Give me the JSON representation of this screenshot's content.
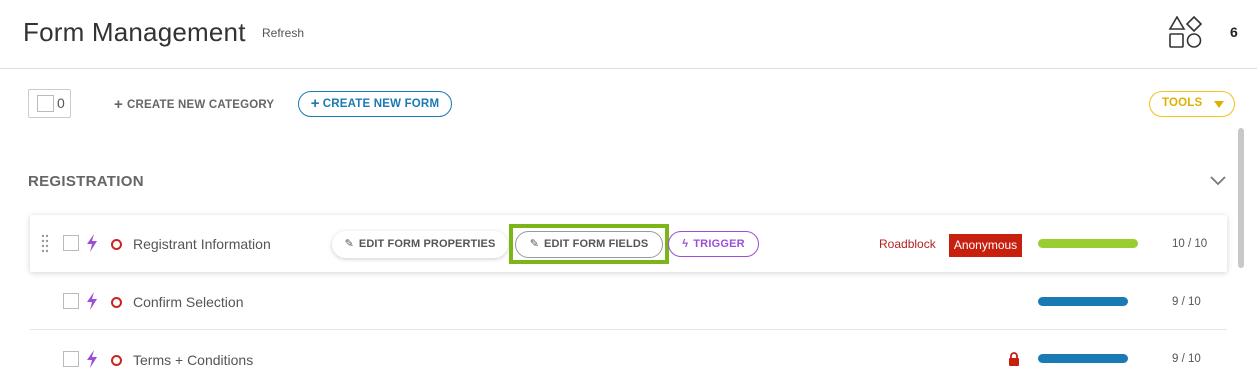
{
  "header": {
    "title": "Form Management",
    "refresh_label": "Refresh",
    "count": "6",
    "shapes_icon": "shapes-icon"
  },
  "toolbar": {
    "selected_count": "0",
    "create_category_label": "CREATE NEW CATEGORY",
    "create_form_label": "CREATE NEW FORM",
    "tools_label": "TOOLS",
    "colors": {
      "primary": "#1a7ab3",
      "tools": "#e0b000"
    }
  },
  "section": {
    "title": "REGISTRATION",
    "collapse_icon": "chevron-down-icon"
  },
  "rows": [
    {
      "name": "Registrant Information",
      "actions": {
        "edit_properties": "EDIT FORM PROPERTIES",
        "edit_fields": "EDIT FORM FIELDS",
        "trigger": "TRIGGER"
      },
      "roadblock": "Roadblock",
      "badge": "Anonymous",
      "progress_text": "10 / 10",
      "progress_value": 1.0,
      "progress_color": "#9acd32"
    },
    {
      "name": "Confirm Selection",
      "progress_text": "9 / 10",
      "progress_value": 0.9,
      "progress_color": "#1a7ab3"
    },
    {
      "name": "Terms + Conditions",
      "locked": true,
      "progress_text": "9 / 10",
      "progress_value": 0.9,
      "progress_color": "#1a7ab3"
    }
  ]
}
